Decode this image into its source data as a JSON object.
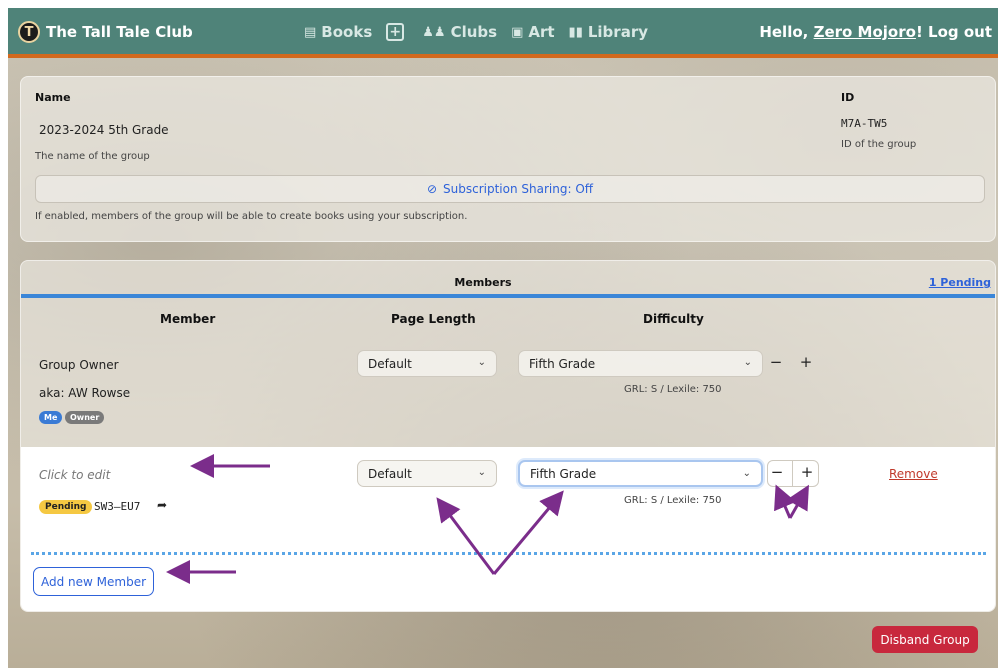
{
  "navbar": {
    "brand_logo": "T",
    "brand_name": "The Tall Tale Club",
    "links": [
      {
        "icon": "book-icon",
        "label": "Books"
      },
      {
        "icon": "plus-box-icon",
        "label": "+"
      },
      {
        "icon": "group-icon",
        "label": "Clubs"
      },
      {
        "icon": "image-icon",
        "label": "Art"
      },
      {
        "icon": "library-icon",
        "label": "Library"
      }
    ],
    "greeting": "Hello, ",
    "username": "Zero Mojoro",
    "exclaim": "!",
    "logout": "Log out",
    "accent_color": "#4f8379",
    "border_color": "#d2691e"
  },
  "group": {
    "name_label": "Name",
    "name_value": "2023-2024 5th Grade",
    "name_help": "The name of the group",
    "id_label": "ID",
    "id_value": "M7A-TW5",
    "id_help": "ID of the group",
    "sharing_button": "Subscription Sharing: Off",
    "sharing_help": "If enabled, members of the group will be able to create books using your subscription."
  },
  "members": {
    "title": "Members",
    "pending_link": "1 Pending",
    "columns": {
      "member": "Member",
      "page_length": "Page Length",
      "difficulty": "Difficulty"
    },
    "rows": [
      {
        "name": "Group Owner",
        "aka": "aka: AW Rowse",
        "badges": [
          "Me",
          "Owner"
        ],
        "page_length": "Default",
        "difficulty": "Fifth Grade",
        "level_info": "GRL: S / Lexile: 750"
      },
      {
        "name_placeholder": "Click to edit",
        "status_badge": "Pending",
        "code": "SW3–EU7",
        "page_length": "Default",
        "difficulty": "Fifth Grade",
        "level_info": "GRL: S / Lexile: 750",
        "remove_label": "Remove"
      }
    ],
    "add_button": "Add new Member",
    "stepper_minus": "−",
    "stepper_plus": "+"
  },
  "disband_button": "Disband Group",
  "colors": {
    "link": "#2e62d9",
    "danger": "#c8283d",
    "annotation_arrow": "#7b2d8b",
    "pending": "#f5c842"
  }
}
